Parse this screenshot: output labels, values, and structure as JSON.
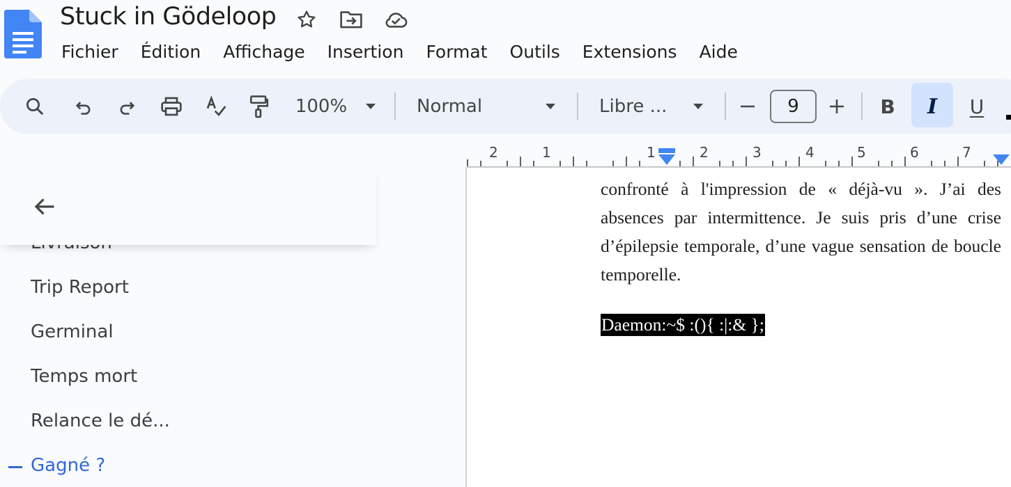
{
  "document": {
    "title": "Stuck in Gödeloop",
    "body_paragraph": "confronté à l'impression de « déjà-vu ». J’ai des absences par intermittence. Je suis pris d’une crise d’épilepsie temporale, d’une vague sensation de boucle temporelle.",
    "highlighted_line": "Daemon:~$ :(){ :|:& };"
  },
  "menu": [
    "Fichier",
    "Édition",
    "Affichage",
    "Insertion",
    "Format",
    "Outils",
    "Extensions",
    "Aide"
  ],
  "toolbar": {
    "zoom": "100%",
    "style": "Normal",
    "font": "Libre ...",
    "font_size": "9",
    "bold_label": "B",
    "italic_label": "I",
    "underline_label": "U"
  },
  "ruler_labels": [
    "2",
    "1",
    "1",
    "2",
    "3",
    "4",
    "5",
    "6",
    "7"
  ],
  "outline": {
    "items": [
      "Livraison",
      "Trip Report",
      "Germinal",
      "Temps mort",
      "Relance le dé...",
      "Gagné ?"
    ],
    "active_index": 5
  },
  "colors": {
    "accent": "#3367d6",
    "toolbar_bg": "#edf2fa",
    "italic_active": "#d3e3fd",
    "logo": "#4285f4"
  }
}
